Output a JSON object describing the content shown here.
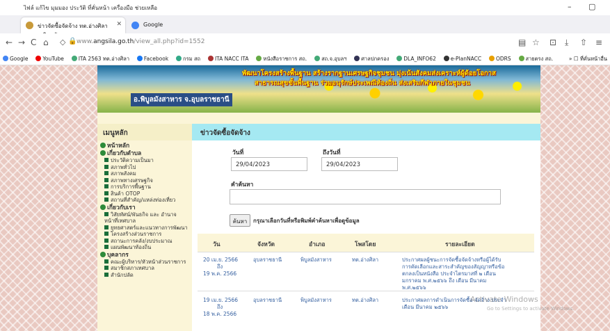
{
  "menubar": {
    "items": "ไฟล์  แก้ไข  มุมมอง  ประวัติ  ที่คั่นหน้า  เครื่องมือ  ช่วยเหลือ",
    "minimize": "–",
    "maximize": "▢"
  },
  "tabs": [
    {
      "label": "ข่าวจัดซื้อจัดจ้าง ทต.อ่างศิลา อ.พิบูลมั"
    },
    {
      "label": "Google"
    }
  ],
  "tab_close": "✕",
  "new_tab": "+",
  "nav": {
    "back": "←",
    "forward": "→",
    "reload": "C",
    "home": "⌂",
    "url_host": "www.",
    "url_domain": "angsila.go.th",
    "url_path": "/view_all.php?id=1552"
  },
  "bookmarks": [
    "Google",
    "YouTube",
    "ITA 2563 ทต.อ่างศิลา",
    "Facebook",
    "กรม สถ",
    "ITA NACC ITA",
    "หนังสือราชการ สถ.",
    "สถ.จ.อุบลฯ",
    "ศาลปกครอง",
    "DLA_INFO62",
    "e-PlanNACC",
    "ODRS",
    "สายตรง สถ."
  ],
  "bookmarks_more": "»  ☐ ที่คั่นหน้าอื่น",
  "banner": {
    "line1": "พัฒนาโครงสร้างพื้นฐาน  สร้างรากฐานเศรษฐกิจชุมชน  มุ่งเน้นสังคมส่งเคราะห์ผู้ด้อยโอกาส",
    "line2": "สาธารณสุขขั้นพื้นฐาน  ร่วมอนุรักษ์ประเพณีท้องถิ่น  ส่งเสริมกีฬาภายในชุมชน",
    "org": "อ.พิบูลมังสาหาร  จ.อุบลราชธานี"
  },
  "sidebar": {
    "title": "เมนูหลัก",
    "items": [
      {
        "type": "h",
        "label": "หน้าหลัก"
      },
      {
        "type": "h",
        "label": "เกี่ยวกับตำบล"
      },
      {
        "type": "i",
        "label": "ประวัติความเป็นมา"
      },
      {
        "type": "i",
        "label": "สภาพทั่วไป"
      },
      {
        "type": "i",
        "label": "สภาพสังคม"
      },
      {
        "type": "i",
        "label": "สภาพทางเศรษฐกิจ"
      },
      {
        "type": "i",
        "label": "การบริการพื้นฐาน"
      },
      {
        "type": "i",
        "label": "สินค้า OTOP"
      },
      {
        "type": "i",
        "label": "สถานที่สำคัญ/แหล่งท่องเที่ยว"
      },
      {
        "type": "h",
        "label": "เกี่ยวกับเรา"
      },
      {
        "type": "i",
        "label": "วิสัยทัศน์/พันธกิจ และ อำนาจหน้าที่เทศบาล"
      },
      {
        "type": "i",
        "label": "ยุทธศาสตร์และแนวทางการพัฒนา"
      },
      {
        "type": "i",
        "label": "โครงสร้างส่วนราชการ"
      },
      {
        "type": "i",
        "label": "สถานะการคลัง/งบประมาณ"
      },
      {
        "type": "i",
        "label": "แผนพัฒนาท้องถิ่น"
      },
      {
        "type": "h",
        "label": "บุคลากร"
      },
      {
        "type": "i",
        "label": "คณะผู้บริหาร/หัวหน้าส่วนราชการ"
      },
      {
        "type": "i",
        "label": "สมาชิกสภาเทศบาล"
      },
      {
        "type": "i",
        "label": "สำนักปลัด"
      }
    ]
  },
  "main": {
    "title": "ข่าวจัดซื้อจัดจ้าง",
    "from_label": "วันที่",
    "to_label": "ถึงวันที่",
    "from_value": "29/04/2023",
    "to_value": "29/04/2023",
    "search_label": "คำค้นหา",
    "search_button": "ค้นหา",
    "hint": "กรุณาเลือกวันที่หรือพิมพ์คำค้นหาเพื่อดูข้อมูล",
    "columns": [
      "วัน",
      "จังหวัด",
      "อำเภอ",
      "โพสโดย",
      "รายละเอียด"
    ],
    "rows": [
      {
        "date": [
          "20 เม.ย. 2566",
          "ถึง",
          "19 พ.ค. 2566"
        ],
        "province": "อุบลราชธานี",
        "district": "พิบูลมังสาหาร",
        "poster": "ทต.อ่างศิลา",
        "detail": [
          "ประกาศผลผู้ชนะการจัดซื้อจัดจ้างหรือผู้ได้รับ",
          "การคัดเลือกและสาระสำคัญของสัญญาหรือข้อ",
          "ตกลงเป็นหนังสือ ประจำไตรมาสที่ ๒ เดือน",
          "มกราคม พ.ศ.๒๕๖๖ ถึง เดือน มีนาคม",
          "พ.ศ.๒๕๖๖"
        ]
      },
      {
        "date": [
          "19 เม.ย. 2566",
          "ถึง",
          "18 พ.ค. 2566"
        ],
        "province": "อุบลราชธานี",
        "district": "พิบูลมังสาหาร",
        "poster": "ทต.อ่างศิลา",
        "detail": [
          "ประกาศผลการดำเนินการจัดซื้อ-จัดจ้าง ประจำ",
          "เดือน มีนาคม ๒๕๖๖"
        ]
      }
    ]
  },
  "watermark": {
    "line1": "Activate Windows",
    "line2": "Go to Settings to activate Windows."
  },
  "colors": {
    "sidebar_bg": "#fbf5d8",
    "title_bar": "#a5e9f2",
    "link": "#3560a0"
  }
}
